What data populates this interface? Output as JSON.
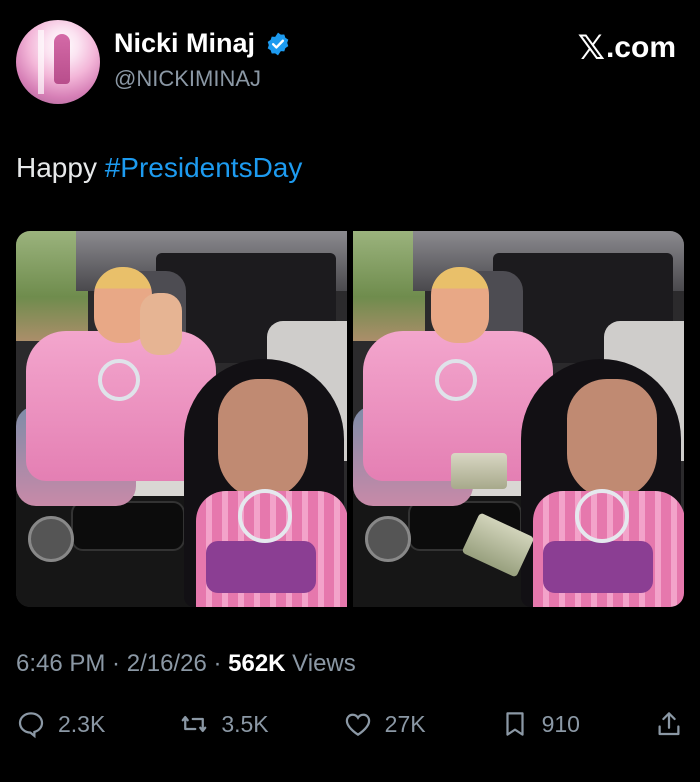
{
  "account": {
    "display_name": "Nicki Minaj",
    "handle": "@NICKIMINAJ",
    "verified": true
  },
  "watermark": {
    "glyph": "𝕏",
    "text": ".com"
  },
  "tweet": {
    "text_prefix": "Happy ",
    "hashtag": "#PresidentsDay"
  },
  "media": {
    "count": 2,
    "items": [
      {
        "icon": "photo-left"
      },
      {
        "icon": "photo-right"
      }
    ]
  },
  "meta": {
    "time": "6:46 PM",
    "sep1": " · ",
    "date": "2/16/26",
    "sep2": " · ",
    "views_count": "562K",
    "views_label": " Views"
  },
  "actions": {
    "replies": "2.3K",
    "reposts": "3.5K",
    "likes": "27K",
    "bookmarks": "910"
  },
  "colors": {
    "background": "#000000",
    "hashtag": "#1d9bf0",
    "secondary_text": "#8b98a5",
    "verified": "#1d9bf0"
  }
}
